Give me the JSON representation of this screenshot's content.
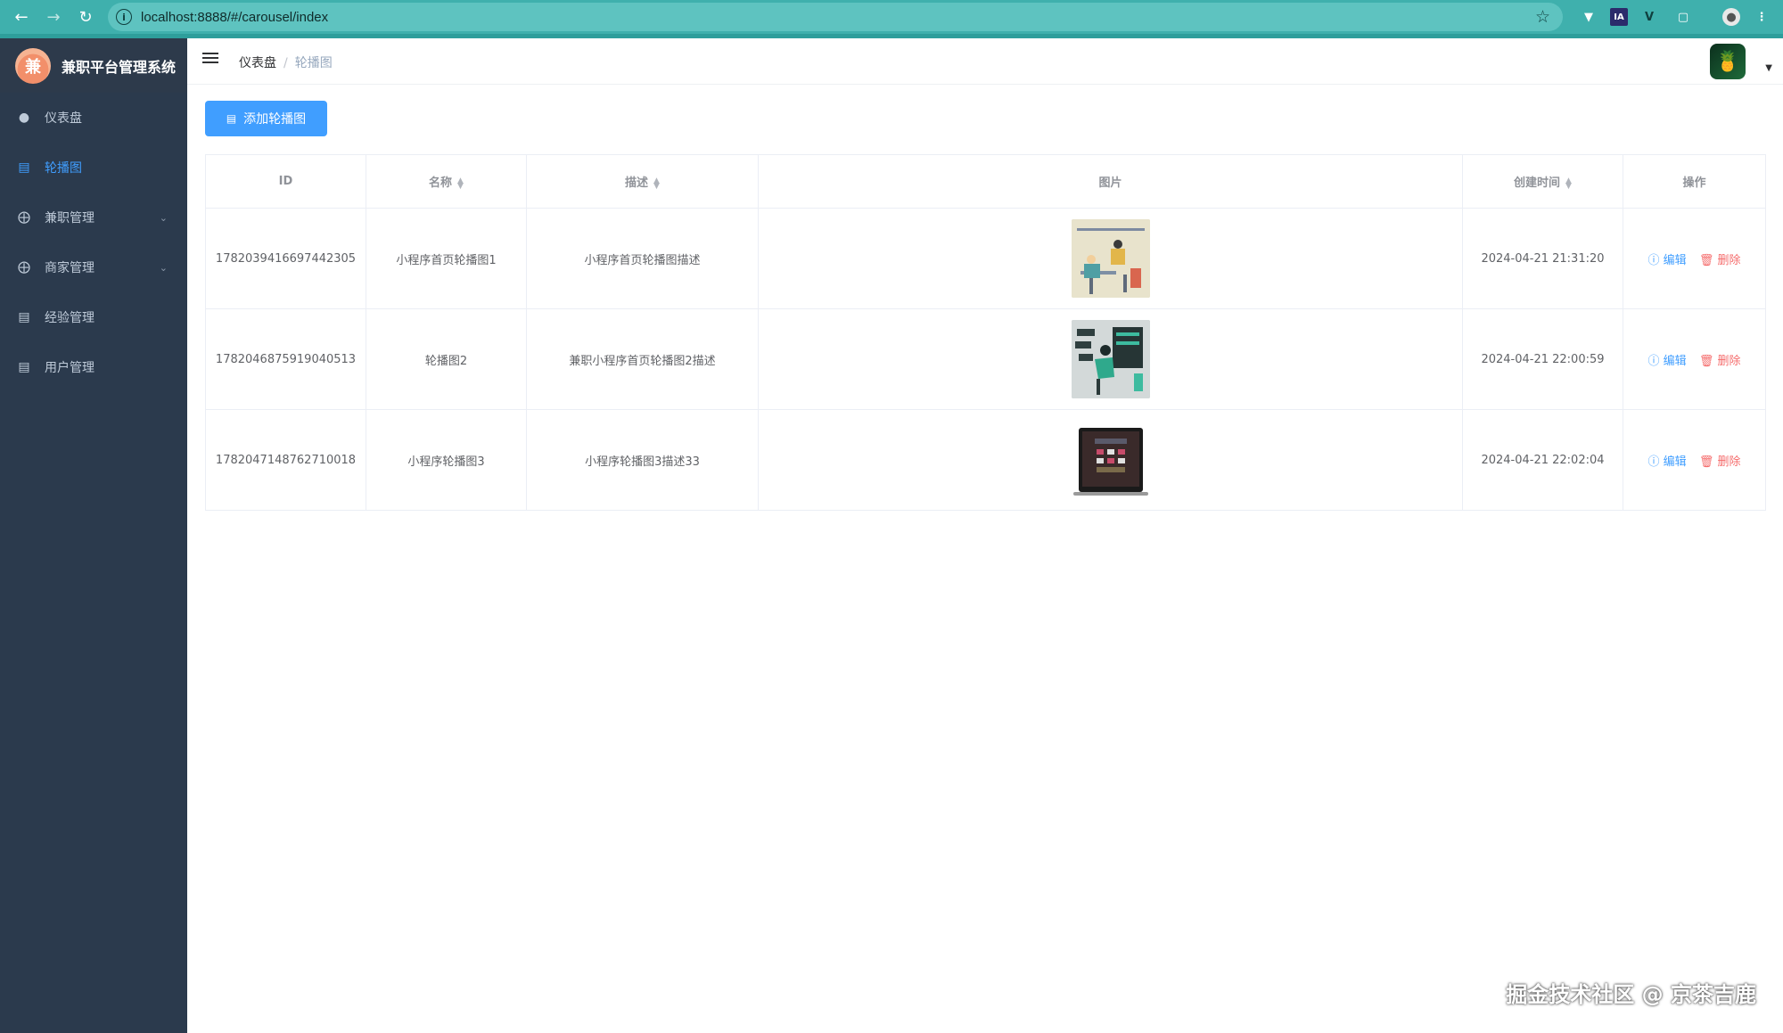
{
  "browser": {
    "url": "localhost:8888/#/carousel/index",
    "ext_labels": [
      "IA",
      "V"
    ]
  },
  "app": {
    "logo_char": "兼",
    "title": "兼职平台管理系统"
  },
  "sidebar": {
    "items": [
      {
        "label": "仪表盘",
        "icon": "dashboard-icon",
        "active": false,
        "has_submenu": false
      },
      {
        "label": "轮播图",
        "icon": "document-icon",
        "active": true,
        "has_submenu": false
      },
      {
        "label": "兼职管理",
        "icon": "circle-plus-icon",
        "active": false,
        "has_submenu": true
      },
      {
        "label": "商家管理",
        "icon": "circle-plus-icon",
        "active": false,
        "has_submenu": true
      },
      {
        "label": "经验管理",
        "icon": "document-icon",
        "active": false,
        "has_submenu": false
      },
      {
        "label": "用户管理",
        "icon": "document-icon",
        "active": false,
        "has_submenu": false
      }
    ]
  },
  "header": {
    "breadcrumb": [
      "仪表盘",
      "轮播图"
    ]
  },
  "toolbar": {
    "add_label": "添加轮播图"
  },
  "table": {
    "columns": [
      "ID",
      "名称",
      "描述",
      "图片",
      "创建时间",
      "操作"
    ],
    "edit_label": "编辑",
    "delete_label": "删除",
    "rows": [
      {
        "id": "1782039416697442305",
        "name": "小程序首页轮播图1",
        "desc": "小程序首页轮播图描述",
        "created": "2024-04-21 21:31:20"
      },
      {
        "id": "1782046875919040513",
        "name": "轮播图2",
        "desc": "兼职小程序首页轮播图2描述",
        "created": "2024-04-21 22:00:59"
      },
      {
        "id": "1782047148762710018",
        "name": "小程序轮播图3",
        "desc": "小程序轮播图3描述33",
        "created": "2024-04-21 22:02:04"
      }
    ]
  },
  "watermark": "掘金技术社区 @ 京茶吉鹿",
  "colors": {
    "primary": "#409eff",
    "danger": "#f56c6c",
    "sidebar_bg": "#2b3a4d",
    "browser_teal": "#3fb0ad"
  }
}
